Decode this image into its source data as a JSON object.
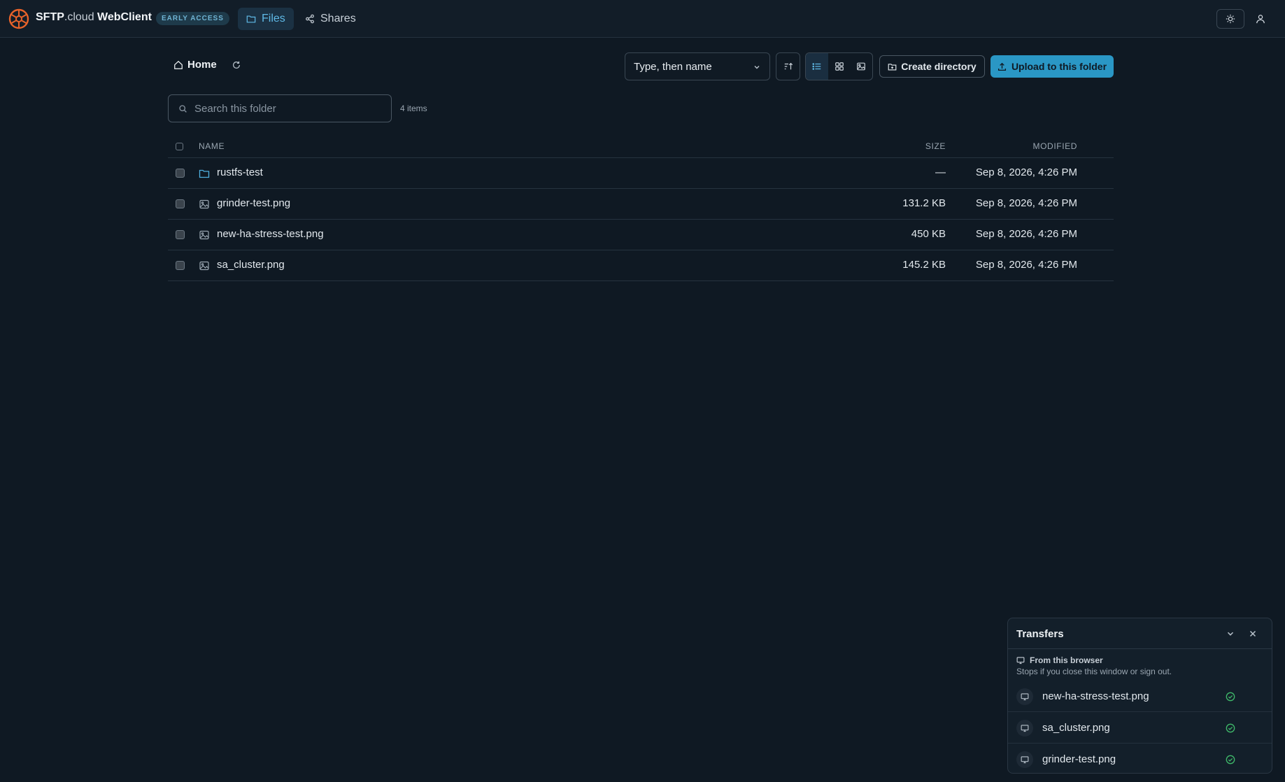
{
  "header": {
    "brand_main": "SFTP",
    "brand_suffix": ".cloud",
    "app_name": "WebClient",
    "badge": "EARLY ACCESS",
    "tabs": [
      {
        "label": "Files",
        "icon": "folder-icon",
        "active": true
      },
      {
        "label": "Shares",
        "icon": "share-icon",
        "active": false
      }
    ],
    "theme_icon": "sun-icon",
    "user_icon": "user-icon"
  },
  "toolbar": {
    "breadcrumb_home": "Home",
    "sort_value": "Type, then name",
    "create_directory_label": "Create directory",
    "upload_label": "Upload to this folder",
    "views": [
      "list-view-icon",
      "grid-view-icon",
      "gallery-view-icon"
    ],
    "active_view": "list"
  },
  "search": {
    "placeholder": "Search this folder",
    "value": "",
    "item_count": "4 items"
  },
  "table": {
    "columns": {
      "name": "NAME",
      "size": "SIZE",
      "modified": "MODIFIED"
    },
    "rows": [
      {
        "type": "folder",
        "name": "rustfs-test",
        "size": "—",
        "modified": "Sep 8, 2026, 4:26 PM"
      },
      {
        "type": "image",
        "name": "grinder-test.png",
        "size": "131.2 KB",
        "modified": "Sep 8, 2026, 4:26 PM"
      },
      {
        "type": "image",
        "name": "new-ha-stress-test.png",
        "size": "450 KB",
        "modified": "Sep 8, 2026, 4:26 PM"
      },
      {
        "type": "image",
        "name": "sa_cluster.png",
        "size": "145.2 KB",
        "modified": "Sep 8, 2026, 4:26 PM"
      }
    ]
  },
  "transfers": {
    "title": "Transfers",
    "section_title": "From this browser",
    "section_subtitle": "Stops if you close this window or sign out.",
    "items": [
      {
        "name": "new-ha-stress-test.png",
        "status": "complete"
      },
      {
        "name": "sa_cluster.png",
        "status": "complete"
      },
      {
        "name": "grinder-test.png",
        "status": "complete"
      }
    ]
  },
  "colors": {
    "background": "#0f1923",
    "accent": "#2a97c5",
    "logo": "#e8632a",
    "success": "#3fb96a"
  }
}
